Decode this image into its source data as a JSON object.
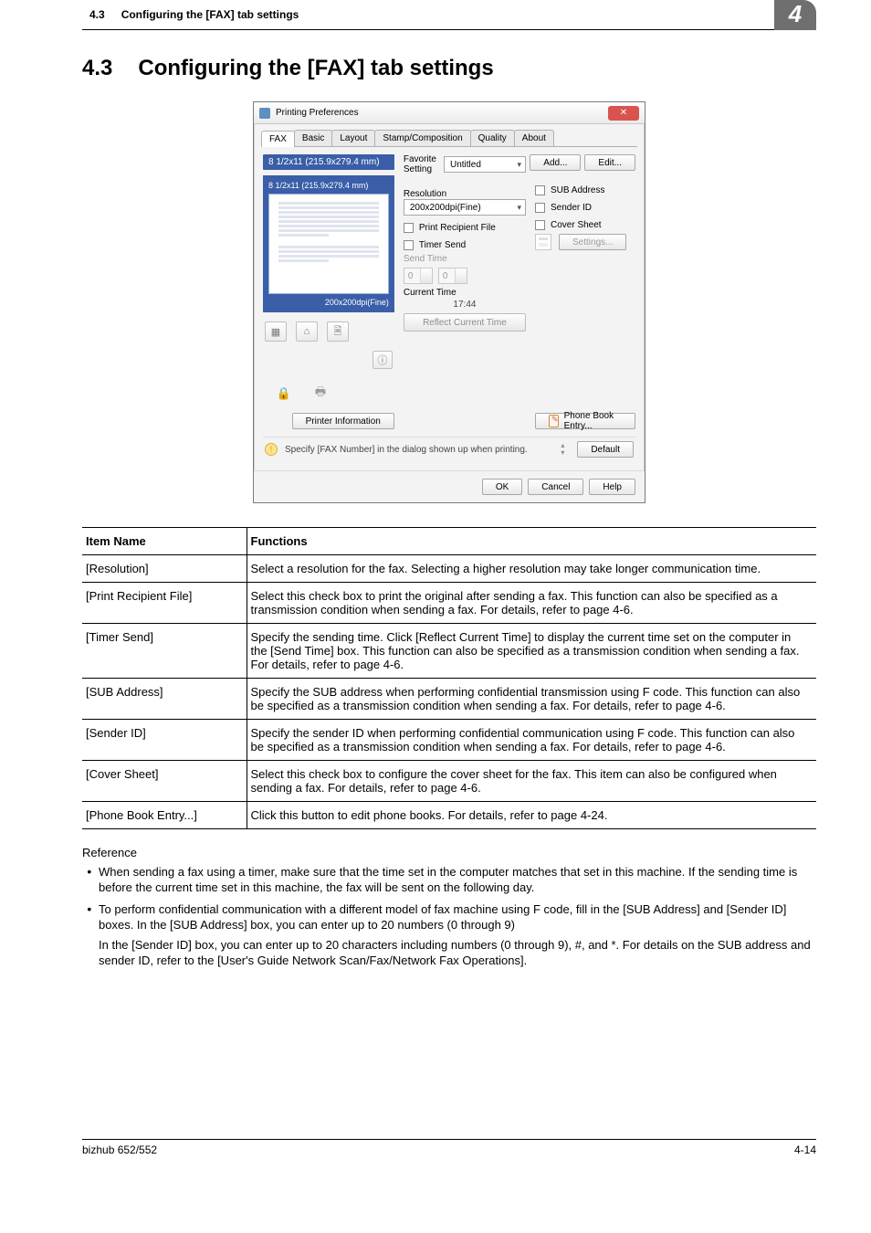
{
  "header": {
    "section_num": "4.3",
    "section_title": "Configuring the [FAX] tab settings",
    "chapter_badge": "4"
  },
  "heading": {
    "num": "4.3",
    "title": "Configuring the [FAX] tab settings"
  },
  "dialog": {
    "title": "Printing Preferences",
    "close_glyph": "✕",
    "tabs": {
      "fax": "FAX",
      "basic": "Basic",
      "layout": "Layout",
      "stamp": "Stamp/Composition",
      "quality": "Quality",
      "about": "About"
    },
    "favorite": {
      "label": "Favorite Setting",
      "value": "Untitled",
      "add_btn": "Add...",
      "edit_btn": "Edit..."
    },
    "left": {
      "paper_size_top": "8 1/2x11 (215.9x279.4 mm)",
      "paper_size_inner": "8 1/2x11 (215.9x279.4 mm)",
      "preview_footer": "200x200dpi(Fine)",
      "printer_info_btn": "Printer Information"
    },
    "mid": {
      "resolution_label": "Resolution",
      "resolution_value": "200x200dpi(Fine)",
      "print_recipient": "Print Recipient File",
      "timer_send": "Timer Send",
      "send_time_label": "Send Time",
      "spin1": "0",
      "spin2": "0",
      "current_time_label": "Current Time",
      "current_time_value": "17:44",
      "reflect_btn": "Reflect Current Time"
    },
    "right": {
      "sub_address": "SUB Address",
      "sender_id": "Sender ID",
      "cover_sheet": "Cover Sheet",
      "settings_btn": "Settings...",
      "phonebook_btn": "Phone Book Entry..."
    },
    "hint": {
      "text": "Specify [FAX Number] in the dialog shown up when printing.",
      "default_btn": "Default"
    },
    "footer": {
      "ok": "OK",
      "cancel": "Cancel",
      "help": "Help"
    }
  },
  "table": {
    "head_item": "Item Name",
    "head_func": "Functions",
    "rows": [
      {
        "item": "[Resolution]",
        "func": "Select a resolution for the fax. Selecting a higher resolution may take longer communication time."
      },
      {
        "item": "[Print Recipient File]",
        "func": "Select this check box to print the original after sending a fax. This function can also be specified as a transmission condition when sending a fax. For details, refer to page 4-6."
      },
      {
        "item": "[Timer Send]",
        "func": "Specify the sending time. Click [Reflect Current Time] to display the current time set on the computer in the [Send Time] box. This function can also be specified as a transmission condition when sending a fax. For details, refer to page 4-6."
      },
      {
        "item": "[SUB Address]",
        "func": "Specify the SUB address when performing confidential transmission using F code. This function can also be specified as a transmission condition when sending a fax. For details, refer to page 4-6."
      },
      {
        "item": "[Sender ID]",
        "func": "Specify the sender ID when performing confidential communication using F code. This function can also be specified as a transmission condition when sending a fax. For details, refer to page 4-6."
      },
      {
        "item": "[Cover Sheet]",
        "func": "Select this check box to configure the cover sheet for the fax. This item can also be configured when sending a fax. For details, refer to page 4-6."
      },
      {
        "item": "[Phone Book Entry...]",
        "func": "Click this button to edit phone books. For details, refer to page 4-24."
      }
    ]
  },
  "reference": {
    "label": "Reference",
    "bullet1": "When sending a fax using a timer, make sure that the time set in the computer matches that set in this machine. If the sending time is before the current time set in this machine, the fax will be sent on the following day.",
    "bullet2": "To perform confidential communication with a different model of fax machine using F code, fill in the [SUB Address] and [Sender ID] boxes. In the [SUB Address] box, you can enter up to 20 numbers (0 through 9)",
    "bullet2_sub": "In the [Sender ID] box, you can enter up to 20 characters including numbers (0 through 9), #, and *. For details on the SUB address and sender ID, refer to the [User's Guide Network Scan/Fax/Network Fax Operations]."
  },
  "footer": {
    "left": "bizhub 652/552",
    "right": "4-14"
  }
}
